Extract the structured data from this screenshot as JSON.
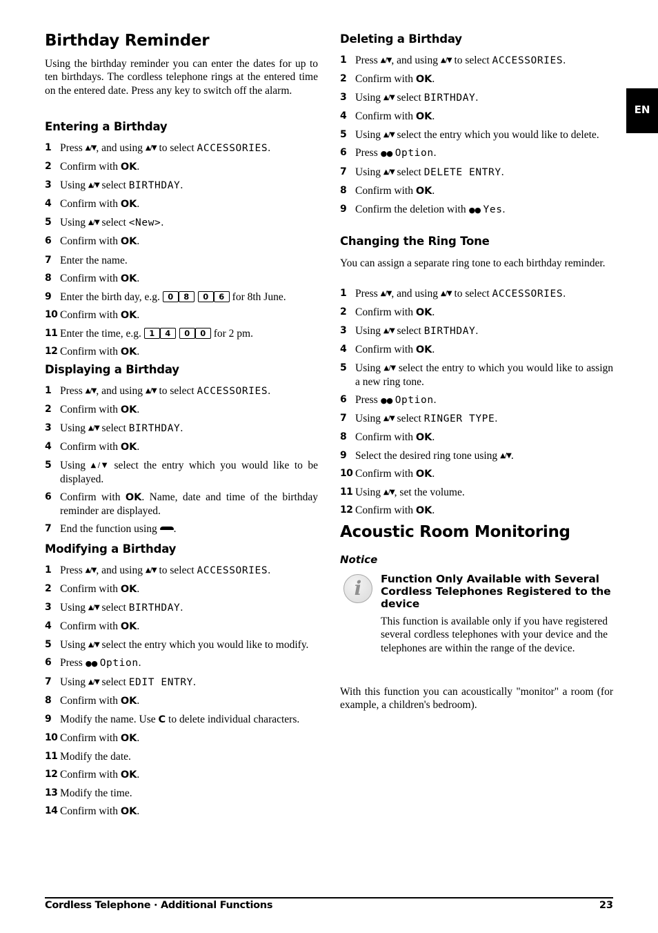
{
  "language_tab": "EN",
  "footer": {
    "title": "Cordless Telephone · Additional Functions",
    "page_number": "23"
  },
  "icons": {
    "up_down_keys": "▲/▼",
    "softkey_dots": "●●",
    "info": "i"
  },
  "birthday_reminder": {
    "title": "Birthday Reminder",
    "intro": "Using the birthday reminder you can enter the dates for up to ten birthdays. The cordless telephone rings at the entered time on the entered date. Press any key to switch off the alarm."
  },
  "entering": {
    "title": "Entering a Birthday",
    "steps": [
      {
        "n": "1",
        "pre": "Press",
        "mid": ", and using",
        "post": "to select",
        "lcd": "ACCESSORIES",
        "end": "."
      },
      {
        "n": "2",
        "text": " Confirm with",
        "ok": "OK",
        "end": "."
      },
      {
        "n": "3",
        "pre": "Using",
        "post": "select",
        "lcd": "BIRTHDAY",
        "end": "."
      },
      {
        "n": "4",
        "text": "Confirm with",
        "ok": "OK",
        "end": "."
      },
      {
        "n": "5",
        "pre": "Using",
        "post": "select",
        "lcd": "<New>",
        "end": "."
      },
      {
        "n": "6",
        "text": "Confirm with",
        "ok": "OK",
        "end": "."
      },
      {
        "n": "7",
        "text": "Enter the name."
      },
      {
        "n": "8",
        "text": "Confirm with",
        "ok": "OK",
        "end": "."
      },
      {
        "n": "9",
        "text": "Enter the birth day, e.g.",
        "keys": [
          "0",
          "8",
          "0",
          "6"
        ],
        "end": "for 8th June."
      },
      {
        "n": "10",
        "text": "Confirm with",
        "ok": "OK",
        "end": "."
      },
      {
        "n": "11",
        "text": "Enter the time, e.g.",
        "keys": [
          "1",
          "4",
          "0",
          "0"
        ],
        "end": "for 2 pm."
      },
      {
        "n": "12",
        "text": "Confirm with",
        "ok": "OK",
        "end": "."
      }
    ]
  },
  "displaying": {
    "title": "Displaying a Birthday",
    "steps": [
      {
        "n": "1",
        "pre": "Press",
        "mid": ", and using",
        "post": "to select",
        "lcd": "ACCESSORIES",
        "end": "."
      },
      {
        "n": "2",
        "text": " Confirm with",
        "ok": "OK",
        "end": "."
      },
      {
        "n": "3",
        "pre": "Using",
        "post": "select",
        "lcd": "BIRTHDAY",
        "end": "."
      },
      {
        "n": "4",
        "text": "Confirm with",
        "ok": "OK",
        "end": "."
      },
      {
        "n": "5",
        "pre": "Using",
        "post": "select the entry which you would like to be displayed."
      },
      {
        "n": "6",
        "text": "Confirm with",
        "ok": "OK",
        "end": ". Name, date and time of the birth­day reminder are displayed."
      },
      {
        "n": "7",
        "text": "End the function using",
        "end": "."
      }
    ]
  },
  "modifying": {
    "title": "Modifying a Birthday",
    "steps": [
      {
        "n": "1",
        "pre": "Press",
        "mid": ", and using",
        "post": "to select",
        "lcd": "ACCESSORIES",
        "end": "."
      },
      {
        "n": "2",
        "text": " Confirm with",
        "ok": "OK",
        "end": "."
      },
      {
        "n": "3",
        "pre": "Using",
        "post": "select",
        "lcd": "BIRTHDAY",
        "end": "."
      },
      {
        "n": "4",
        "text": "Confirm with",
        "ok": "OK",
        "end": "."
      },
      {
        "n": "5",
        "pre": "Using",
        "post": "select the entry which you would like to modify."
      },
      {
        "n": "6",
        "text": "Press",
        "lcd": "Option",
        "end": "."
      },
      {
        "n": "7",
        "pre": "Using",
        "post": "select",
        "lcd": "EDIT ENTRY",
        "end": "."
      },
      {
        "n": "8",
        "text": "Confirm with",
        "ok": "OK",
        "end": "."
      },
      {
        "n": "9",
        "text": "Modify the name. Use",
        "ok": "C",
        "end": "to delete individual charac­ters."
      },
      {
        "n": "10",
        "text": "Confirm with",
        "ok": "OK",
        "end": "."
      },
      {
        "n": "11",
        "text": "Modify the date."
      },
      {
        "n": "12",
        "text": "Confirm with",
        "ok": "OK",
        "end": "."
      },
      {
        "n": "13",
        "text": "Modify the time."
      },
      {
        "n": "14",
        "text": "Confirm with",
        "ok": "OK",
        "end": "."
      }
    ]
  },
  "deleting": {
    "title": "Deleting a Birthday",
    "steps": [
      {
        "n": "1",
        "pre": "Press",
        "mid": ", and using",
        "post": "to select",
        "lcd": "ACCESSORIES",
        "end": "."
      },
      {
        "n": "2",
        "text": " Confirm with",
        "ok": "OK",
        "end": "."
      },
      {
        "n": "3",
        "pre": "Using",
        "post": "select",
        "lcd": "BIRTHDAY",
        "end": "."
      },
      {
        "n": "4",
        "text": "Confirm with",
        "ok": "OK",
        "end": "."
      },
      {
        "n": "5",
        "pre": "Using",
        "post": "select the entry which you would like to delete."
      },
      {
        "n": "6",
        "text": "Press",
        "lcd": "Option",
        "end": "."
      },
      {
        "n": "7",
        "pre": "Using",
        "post": "select",
        "lcd": "DELETE ENTRY",
        "end": "."
      },
      {
        "n": "8",
        "text": "Confirm with",
        "ok": "OK",
        "end": "."
      },
      {
        "n": "9",
        "text": "Confirm the deletion with",
        "lcd": "Yes",
        "end": "."
      }
    ]
  },
  "ring_tone": {
    "title": "Changing the Ring Tone",
    "intro": "You can assign a separate ring tone to each birthday reminder.",
    "steps": [
      {
        "n": "1",
        "pre": "Press",
        "mid": ", and using",
        "post": "to select",
        "lcd": "ACCESSORIES",
        "end": "."
      },
      {
        "n": "2",
        "text": " Confirm with",
        "ok": "OK",
        "end": "."
      },
      {
        "n": "3",
        "pre": "Using",
        "post": "select",
        "lcd": "BIRTHDAY",
        "end": "."
      },
      {
        "n": "4",
        "text": "Confirm with",
        "ok": "OK",
        "end": "."
      },
      {
        "n": "5",
        "pre": "Using",
        "post": "select the entry to which you would like to assign a new ring tone."
      },
      {
        "n": "6",
        "text": "Press",
        "lcd": "Option",
        "end": "."
      },
      {
        "n": "7",
        "pre": "Using",
        "post": "select",
        "lcd": "RINGER TYPE",
        "end": "."
      },
      {
        "n": "8",
        "text": "Confirm with",
        "ok": "OK",
        "end": "."
      },
      {
        "n": "9",
        "text": "Select the desired ring tone using",
        "end": "."
      },
      {
        "n": "10",
        "text": "Confirm with",
        "ok": "OK",
        "end": "."
      },
      {
        "n": "11",
        "text": "Using",
        "end": ", set the volume."
      },
      {
        "n": "12",
        "text": "Confirm with",
        "ok": "OK",
        "end": "."
      }
    ]
  },
  "acoustic": {
    "title": "Acoustic Room Monitoring",
    "notice_label": "Notice",
    "notice_title": "Function Only Available with Several Cordless Telephones Registered to the device",
    "notice_body": "This function is available only if you have regis­tered several cordless telephones with your device and the telephones are within the range of the device.",
    "body": "With this function you can acoustically \"monitor\" a room (for example, a children's bedroom)."
  }
}
